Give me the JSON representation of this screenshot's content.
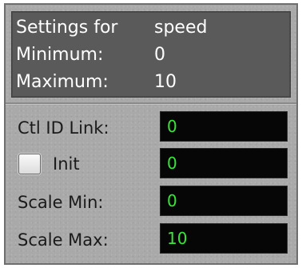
{
  "settings": {
    "title_label": "Settings for",
    "title_value": "speed",
    "min_label": "Minimum:",
    "min_value": "0",
    "max_label": "Maximum:",
    "max_value": "10"
  },
  "fields": {
    "ctl_id_link": {
      "label": "Ctl ID Link:",
      "value": "0"
    },
    "init": {
      "label": "Init",
      "value": "0",
      "checked": false
    },
    "scale_min": {
      "label": "Scale Min:",
      "value": "0"
    },
    "scale_max": {
      "label": "Scale Max:",
      "value": "10"
    }
  },
  "colors": {
    "field_text": "#37e637",
    "field_bg": "#060606",
    "info_bg": "#5a5a5a",
    "panel_bg": "#a9a9a9"
  }
}
